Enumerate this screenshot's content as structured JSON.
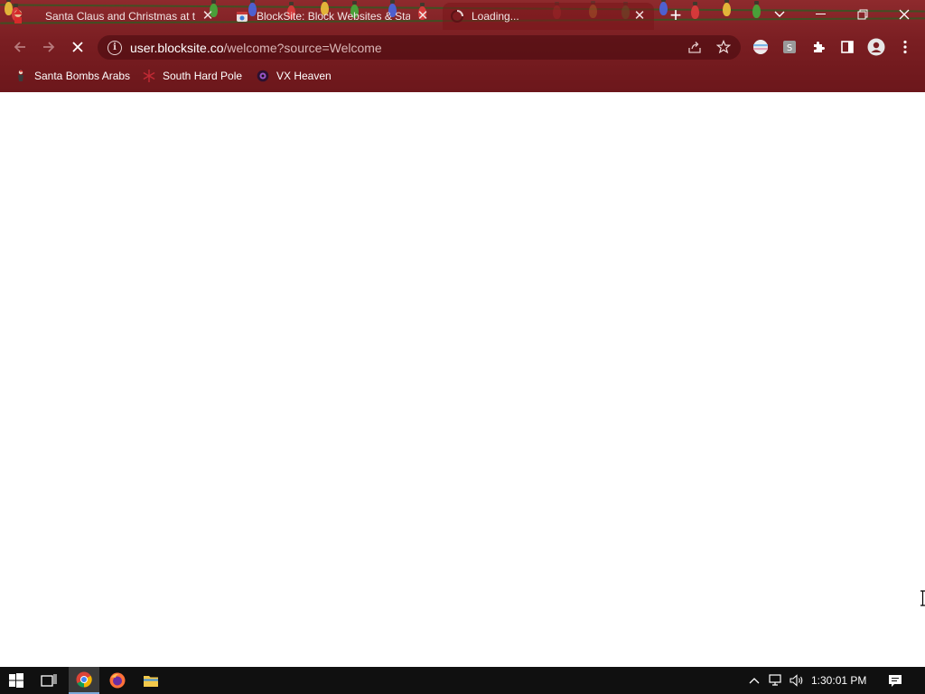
{
  "tabs": [
    {
      "title": "Santa Claus and Christmas at the",
      "icon": "santa-favicon",
      "active": false
    },
    {
      "title": "BlockSite: Block Websites & Stay",
      "icon": "blocksite-favicon",
      "active": false
    },
    {
      "title": "Loading...",
      "icon": "loading-spinner",
      "active": true
    }
  ],
  "address": {
    "host": "user.blocksite.co",
    "path": "/welcome?source=Welcome"
  },
  "bookmarks": [
    {
      "label": "Santa Bombs Arabs",
      "icon": "santa-figure-icon"
    },
    {
      "label": "South Hard Pole",
      "icon": "snowflake-icon"
    },
    {
      "label": "VX Heaven",
      "icon": "vx-eye-icon"
    }
  ],
  "taskbar": {
    "time": "1:30:01 PM"
  },
  "colors": {
    "chrome_bg": "#7a1e22",
    "page_bg": "#ffffff",
    "taskbar_bg": "#101010"
  }
}
